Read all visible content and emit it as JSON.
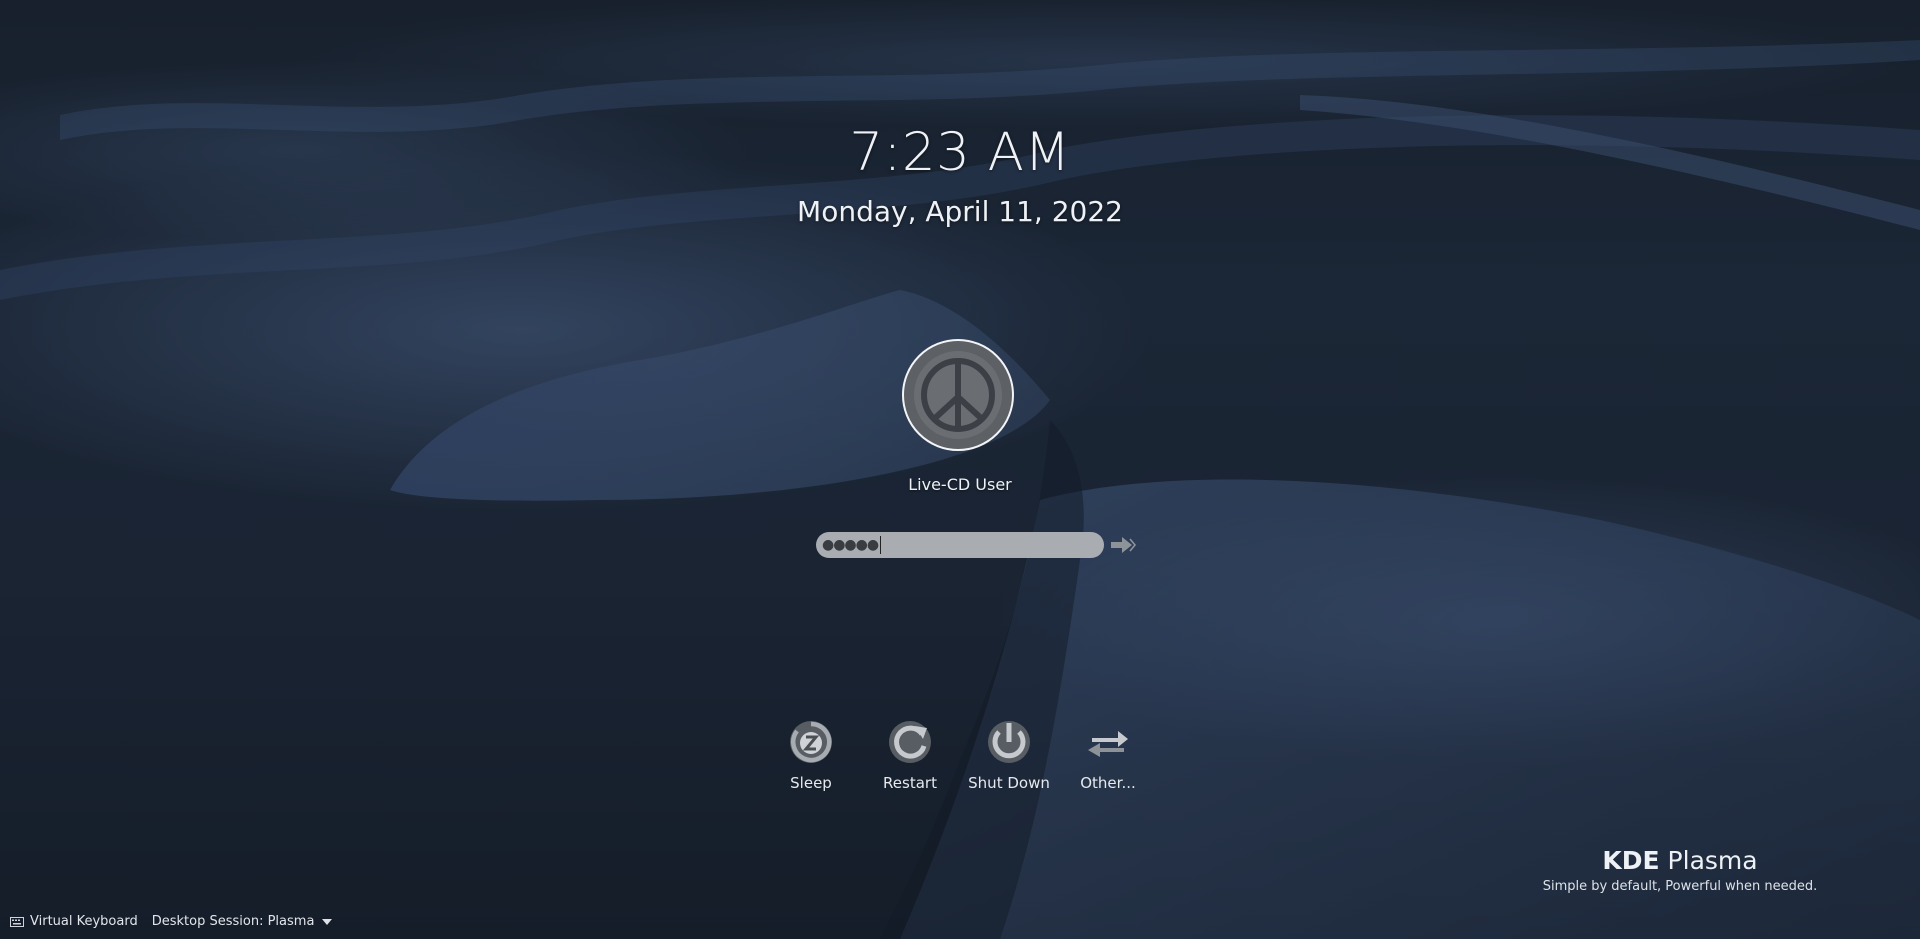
{
  "clock": {
    "time": "7:23 AM",
    "date": "Monday, April 11, 2022"
  },
  "user": {
    "name": "Live-CD User",
    "avatar_icon": "peace-sign-icon"
  },
  "password": {
    "masked_value": "●●●●●",
    "submit_icon": "login-arrow-icon"
  },
  "actions": [
    {
      "label": "Sleep",
      "icon": "sleep-icon"
    },
    {
      "label": "Restart",
      "icon": "restart-icon"
    },
    {
      "label": "Shut Down",
      "icon": "shutdown-icon"
    },
    {
      "label": "Other...",
      "icon": "switch-user-icon"
    }
  ],
  "branding": {
    "brand_bold": "KDE",
    "brand_light": "Plasma",
    "tagline": "Simple by default, Powerful when needed."
  },
  "footer": {
    "virtual_keyboard": "Virtual Keyboard",
    "session_label": "Desktop Session: Plasma"
  },
  "colors": {
    "background": "#1a2433",
    "dune": "#3a4d6b",
    "text": "#eef1f5",
    "field": "#a9adb2"
  }
}
